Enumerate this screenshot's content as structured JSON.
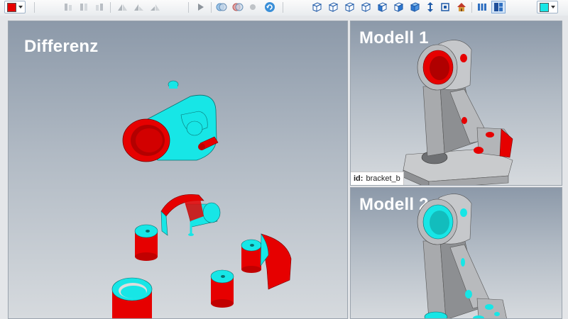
{
  "views": {
    "main": {
      "title": "Differenz"
    },
    "top_right": {
      "title": "Modell 1",
      "id_label": "id:",
      "id_value": "bracket_b"
    },
    "bottom_right": {
      "title": "Modell 2"
    }
  },
  "colors": {
    "cyan": "#17e6e6",
    "red": "#e60000",
    "gray": "#9a9c9e",
    "light_gray": "#c9cbcd"
  },
  "toolbar_icons": [
    "color-picker-icon",
    "align-left-icon",
    "align-center-icon",
    "align-right-icon",
    "mirror-icon",
    "mirror-up-icon",
    "mirror-down-icon",
    "play-icon",
    "compare-both-icon",
    "compare-red-icon",
    "compare-gray-icon",
    "refresh-icon",
    "view-iso-1-icon",
    "view-iso-2-icon",
    "view-iso-3-icon",
    "view-iso-4-icon",
    "view-iso-5-icon",
    "view-iso-6-icon",
    "view-cube-icon",
    "axis-icon",
    "fit-icon",
    "home-icon",
    "layout-columns-icon",
    "layout-grid-icon",
    "color-picker-cyan-icon"
  ]
}
